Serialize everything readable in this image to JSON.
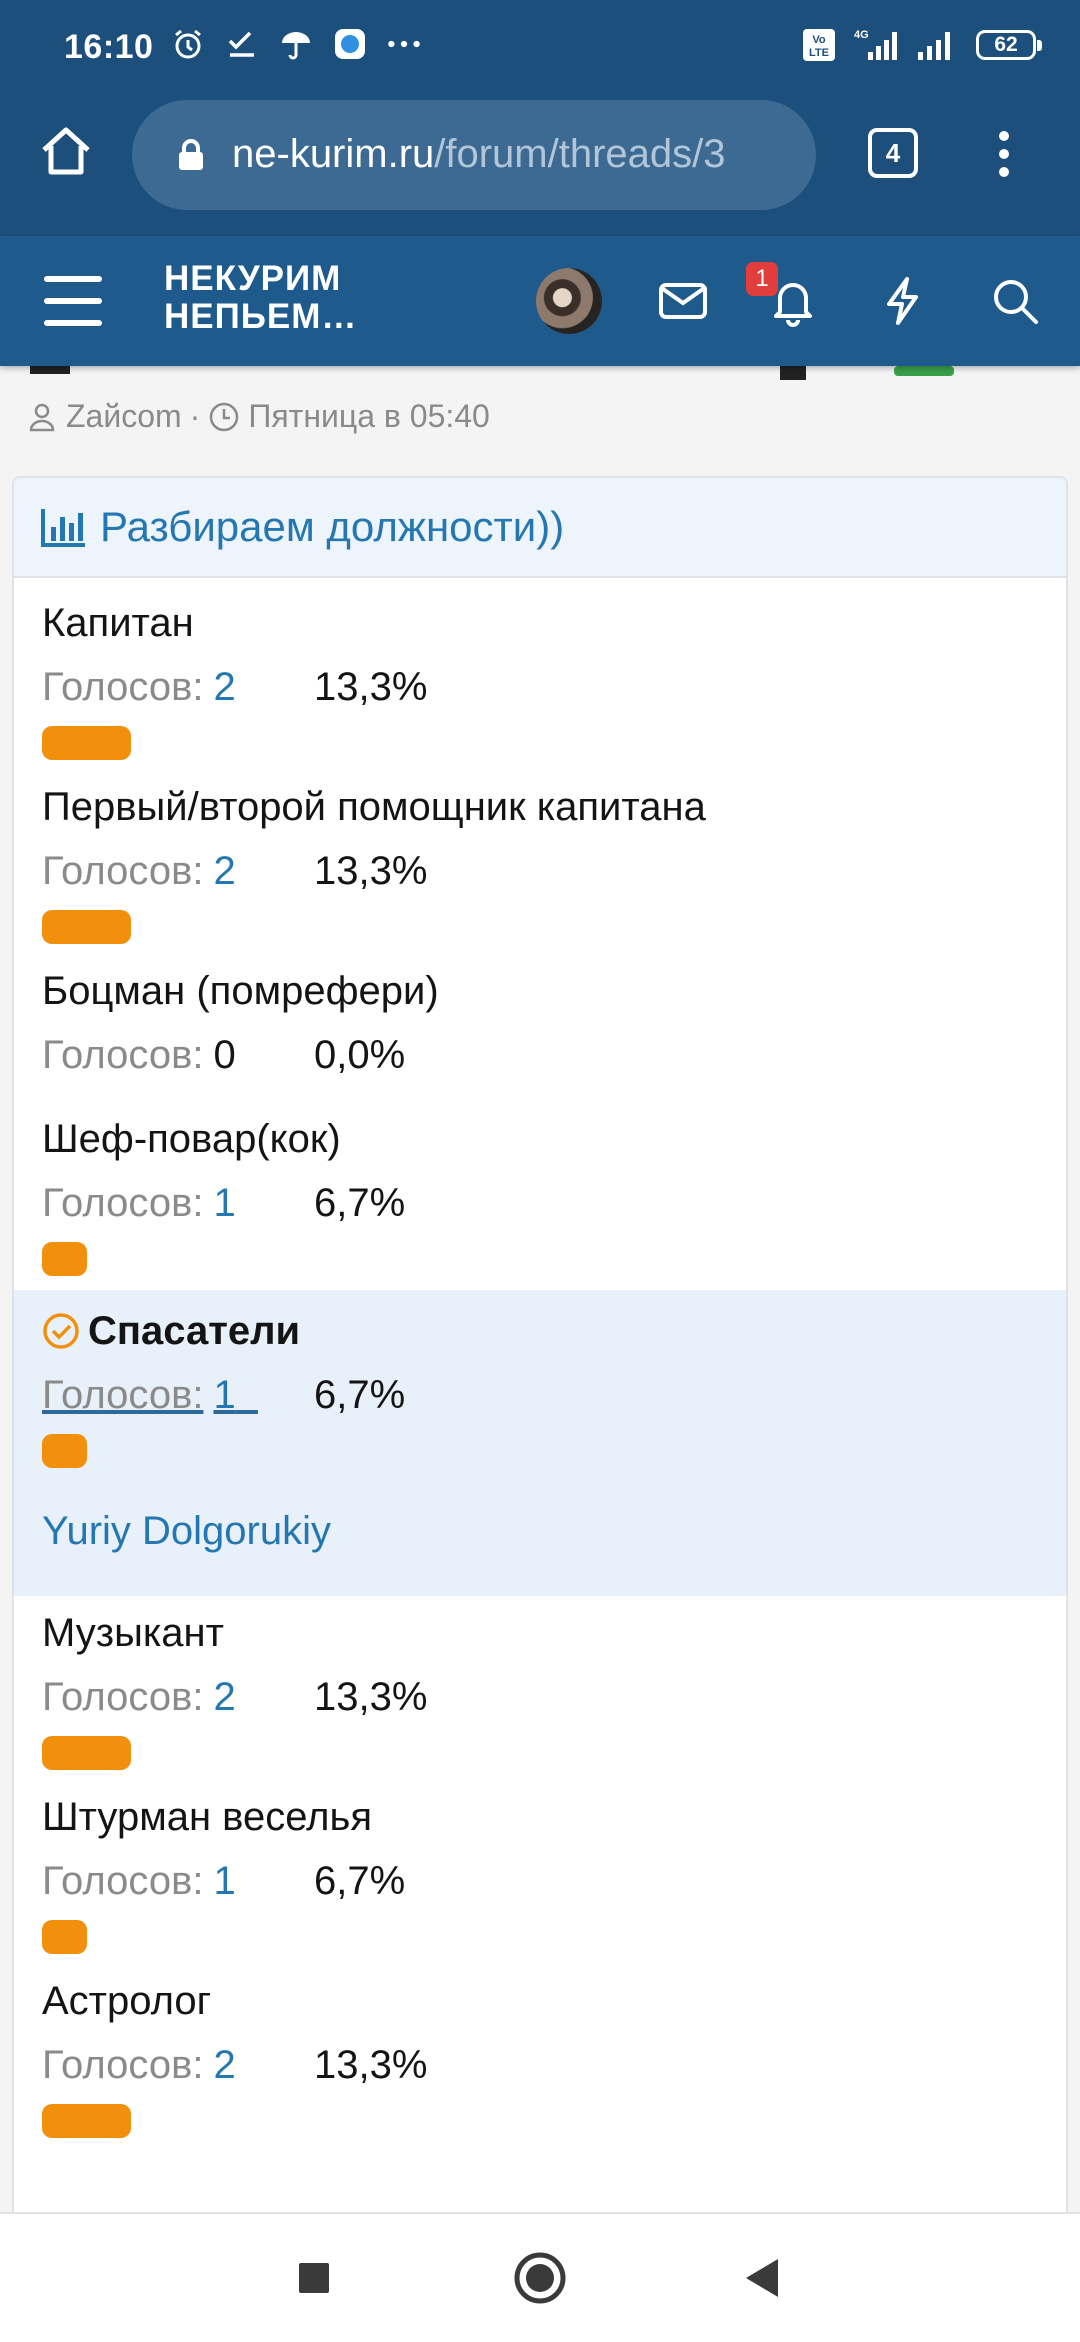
{
  "status_bar": {
    "time": "16:10",
    "battery": "62",
    "network": "4G",
    "volte": "Vo LTE",
    "icons": [
      "alarm-icon",
      "task-check-icon",
      "umbrella-icon",
      "app-icon",
      "more-dots-icon",
      "volte-icon",
      "signal-icon",
      "signal-icon",
      "battery-icon"
    ]
  },
  "browser": {
    "url_host": "ne-kurim.ru",
    "url_path": "/forum/threads/3",
    "tab_count": "4"
  },
  "site_header": {
    "logo_line1": "НЕКУРИМ",
    "logo_line2": "НЕПЬЕМ…",
    "notification_count": "1"
  },
  "thread_meta": {
    "author": "Zaйcom",
    "separator": "·",
    "date": "Пятница в 05:40"
  },
  "poll": {
    "title": "Разбираем должности))",
    "votes_label": "Голосов:",
    "responses": [
      {
        "name": "Капитан",
        "votes": "2",
        "percent": "13,3%",
        "fraction": 0.133
      },
      {
        "name": "Первый/второй помощник капитана",
        "votes": "2",
        "percent": "13,3%",
        "fraction": 0.133
      },
      {
        "name": "Боцман (помрефери)",
        "votes": "0",
        "percent": "0,0%",
        "fraction": 0.0
      },
      {
        "name": "Шеф-повар(кок)",
        "votes": "1",
        "percent": "6,7%",
        "fraction": 0.067
      },
      {
        "name": "Спасатели",
        "votes": "1",
        "percent": "6,7%",
        "fraction": 0.067,
        "selected": true,
        "voter": "Yuriy Dolgorukiy"
      },
      {
        "name": "Музыкант",
        "votes": "2",
        "percent": "13,3%",
        "fraction": 0.133
      },
      {
        "name": "Штурман веселья",
        "votes": "1",
        "percent": "6,7%",
        "fraction": 0.067
      },
      {
        "name": "Астролог",
        "votes": "2",
        "percent": "13,3%",
        "fraction": 0.133
      }
    ]
  },
  "colors": {
    "header_bg": "#1f5a8c",
    "status_bg": "#1c4f7c",
    "link_blue": "#2577b1",
    "bar_orange": "#f2900e",
    "selected_bg": "#e8f1fa"
  }
}
